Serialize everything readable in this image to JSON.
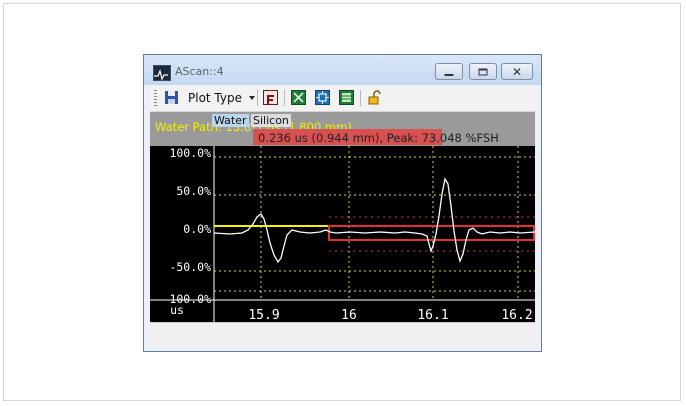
{
  "window": {
    "title": "AScan::4"
  },
  "toolbar": {
    "plot_type_label": "Plot Type"
  },
  "info": {
    "water_tab": "Water",
    "silicon_tab": "Silicon",
    "water_path": "Water Path: 13.8?? us (1.800 mm)",
    "peak_readout": "0.236 us (0.944 mm), Peak: 73.048 %FSH"
  },
  "plot": {
    "y_ticks": [
      "100.0%",
      "50.0%",
      "0.0%",
      "-50.0%",
      "-100.0%"
    ],
    "x_unit": "us",
    "x_ticks": [
      "15.9",
      "16",
      "16.1",
      "16.2"
    ]
  },
  "colors": {
    "background": "#000000",
    "grid": "#d8d84a",
    "signal": "#ffffff",
    "gate_water": "#f4f000",
    "gate_silicon": "#e23030"
  }
}
